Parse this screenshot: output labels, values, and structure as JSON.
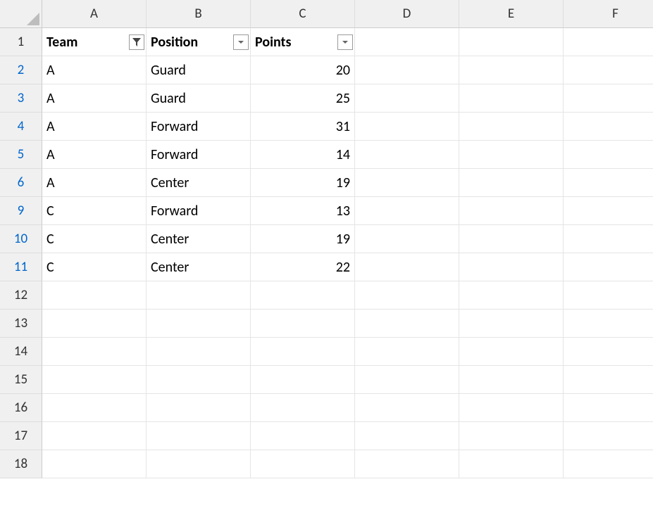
{
  "columns": [
    "A",
    "B",
    "C",
    "D",
    "E",
    "F"
  ],
  "row_numbers": [
    1,
    2,
    3,
    4,
    5,
    6,
    9,
    10,
    11,
    12,
    13,
    14,
    15,
    16,
    17,
    18
  ],
  "filtered_row_numbers": [
    2,
    3,
    4,
    5,
    6,
    9,
    10,
    11
  ],
  "headers": {
    "team": "Team",
    "position": "Position",
    "points": "Points"
  },
  "filters": {
    "team": "applied",
    "position": "none",
    "points": "none"
  },
  "rows": [
    {
      "rn": 2,
      "team": "A",
      "position": "Guard",
      "points": 20
    },
    {
      "rn": 3,
      "team": "A",
      "position": "Guard",
      "points": 25
    },
    {
      "rn": 4,
      "team": "A",
      "position": "Forward",
      "points": 31
    },
    {
      "rn": 5,
      "team": "A",
      "position": "Forward",
      "points": 14
    },
    {
      "rn": 6,
      "team": "A",
      "position": "Center",
      "points": 19
    },
    {
      "rn": 9,
      "team": "C",
      "position": "Forward",
      "points": 13
    },
    {
      "rn": 10,
      "team": "C",
      "position": "Center",
      "points": 19
    },
    {
      "rn": 11,
      "team": "C",
      "position": "Center",
      "points": 22
    }
  ]
}
